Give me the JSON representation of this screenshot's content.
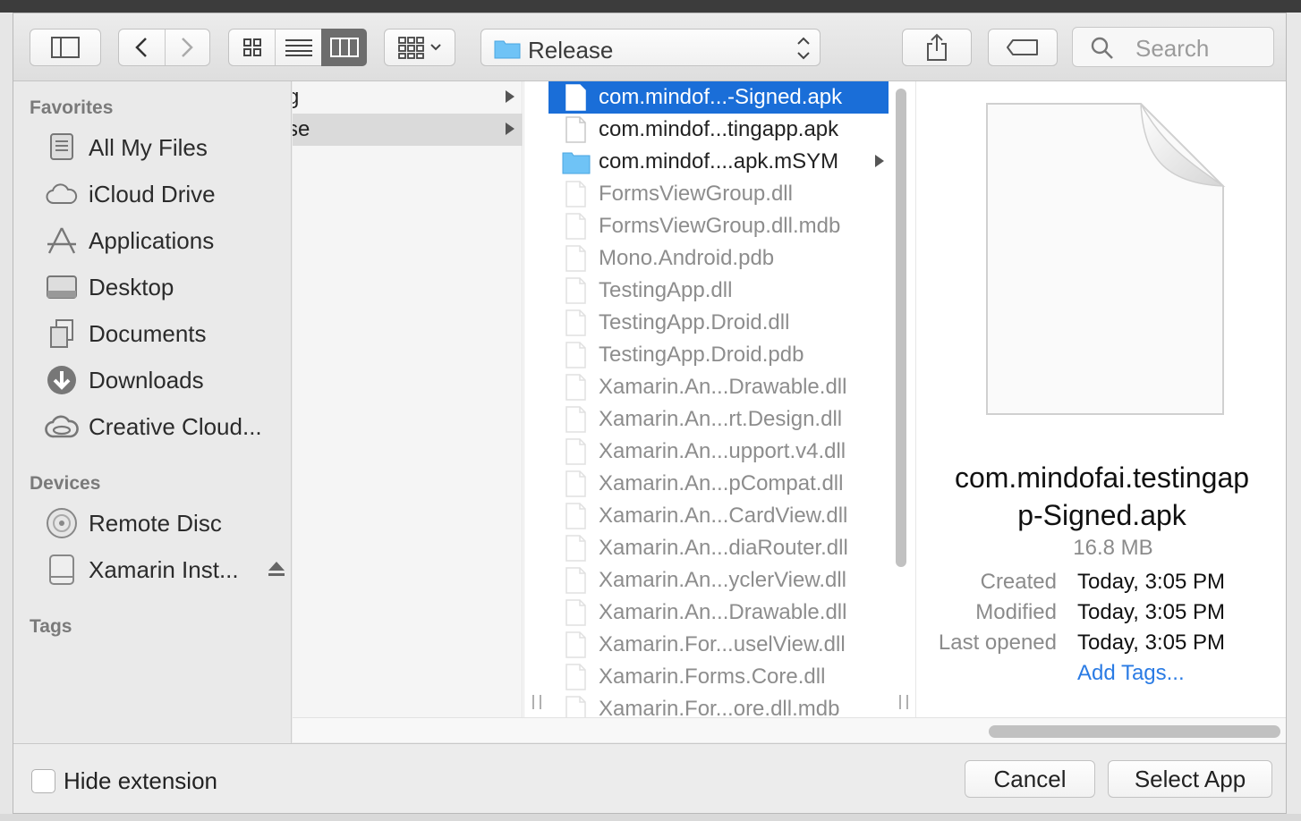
{
  "toolbar": {
    "path_popup_label": "Release",
    "search_placeholder": "Search"
  },
  "sidebar": {
    "sections": {
      "favorites": "Favorites",
      "devices": "Devices",
      "tags": "Tags"
    },
    "favorites": [
      {
        "label": "All My Files",
        "icon": "all-my-files-icon"
      },
      {
        "label": "iCloud Drive",
        "icon": "cloud-icon"
      },
      {
        "label": "Applications",
        "icon": "applications-icon"
      },
      {
        "label": "Desktop",
        "icon": "desktop-icon"
      },
      {
        "label": "Documents",
        "icon": "documents-icon"
      },
      {
        "label": "Downloads",
        "icon": "downloads-icon"
      },
      {
        "label": "Creative Cloud...",
        "icon": "creative-cloud-icon"
      }
    ],
    "devices": [
      {
        "label": "Remote Disc",
        "icon": "disc-icon"
      },
      {
        "label": "Xamarin Inst...",
        "icon": "drive-icon"
      }
    ]
  },
  "column1": {
    "rows": [
      {
        "label": "g"
      },
      {
        "label": "se"
      }
    ]
  },
  "column2": {
    "files": [
      {
        "name": "com.mindof...-Signed.apk",
        "kind": "file",
        "selected": true,
        "dim": false
      },
      {
        "name": "com.mindof...tingapp.apk",
        "kind": "file",
        "selected": false,
        "dim": false
      },
      {
        "name": "com.mindof....apk.mSYM",
        "kind": "folder",
        "selected": false,
        "dim": false
      },
      {
        "name": "FormsViewGroup.dll",
        "kind": "file",
        "selected": false,
        "dim": true
      },
      {
        "name": "FormsViewGroup.dll.mdb",
        "kind": "file",
        "selected": false,
        "dim": true
      },
      {
        "name": "Mono.Android.pdb",
        "kind": "file",
        "selected": false,
        "dim": true
      },
      {
        "name": "TestingApp.dll",
        "kind": "file",
        "selected": false,
        "dim": true
      },
      {
        "name": "TestingApp.Droid.dll",
        "kind": "file",
        "selected": false,
        "dim": true
      },
      {
        "name": "TestingApp.Droid.pdb",
        "kind": "file",
        "selected": false,
        "dim": true
      },
      {
        "name": "Xamarin.An...Drawable.dll",
        "kind": "file",
        "selected": false,
        "dim": true
      },
      {
        "name": "Xamarin.An...rt.Design.dll",
        "kind": "file",
        "selected": false,
        "dim": true
      },
      {
        "name": "Xamarin.An...upport.v4.dll",
        "kind": "file",
        "selected": false,
        "dim": true
      },
      {
        "name": "Xamarin.An...pCompat.dll",
        "kind": "file",
        "selected": false,
        "dim": true
      },
      {
        "name": "Xamarin.An...CardView.dll",
        "kind": "file",
        "selected": false,
        "dim": true
      },
      {
        "name": "Xamarin.An...diaRouter.dll",
        "kind": "file",
        "selected": false,
        "dim": true
      },
      {
        "name": "Xamarin.An...yclerView.dll",
        "kind": "file",
        "selected": false,
        "dim": true
      },
      {
        "name": "Xamarin.An...Drawable.dll",
        "kind": "file",
        "selected": false,
        "dim": true
      },
      {
        "name": "Xamarin.For...uselView.dll",
        "kind": "file",
        "selected": false,
        "dim": true
      },
      {
        "name": "Xamarin.Forms.Core.dll",
        "kind": "file",
        "selected": false,
        "dim": true
      },
      {
        "name": "Xamarin.For...ore.dll.mdb",
        "kind": "file",
        "selected": false,
        "dim": true
      }
    ]
  },
  "preview": {
    "name_line1": "com.mindofai.testingap",
    "name_line2": "p-Signed.apk",
    "size": "16.8 MB",
    "created_label": "Created",
    "created_value": "Today, 3:05 PM",
    "modified_label": "Modified",
    "modified_value": "Today, 3:05 PM",
    "opened_label": "Last opened",
    "opened_value": "Today, 3:05 PM",
    "add_tags": "Add Tags..."
  },
  "footer": {
    "hide_extension": "Hide extension",
    "cancel": "Cancel",
    "select": "Select App"
  },
  "colors": {
    "selection": "#1a6ed8",
    "link": "#2a7be4",
    "folder": "#6fc3f6"
  }
}
